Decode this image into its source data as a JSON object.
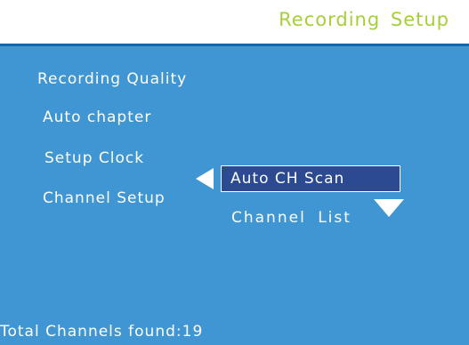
{
  "header": {
    "title": "Recording  Setup"
  },
  "menu": {
    "items": [
      {
        "label": "Recording Quality"
      },
      {
        "label": "Auto chapter"
      },
      {
        "label": "Setup Clock"
      },
      {
        "label": "Channel Setup"
      }
    ]
  },
  "submenu": {
    "selected_label": "Auto CH Scan",
    "items": [
      {
        "label": "Channel  List"
      }
    ]
  },
  "status": {
    "label": "Total  Channels found:",
    "count": "19"
  },
  "colors": {
    "title": "#a6cf3a",
    "panel": "#3f96d3",
    "selected_bg": "#2b4a92",
    "text": "#ffffff"
  },
  "icons": {
    "left": "triangle-left-icon",
    "down": "triangle-down-icon"
  }
}
